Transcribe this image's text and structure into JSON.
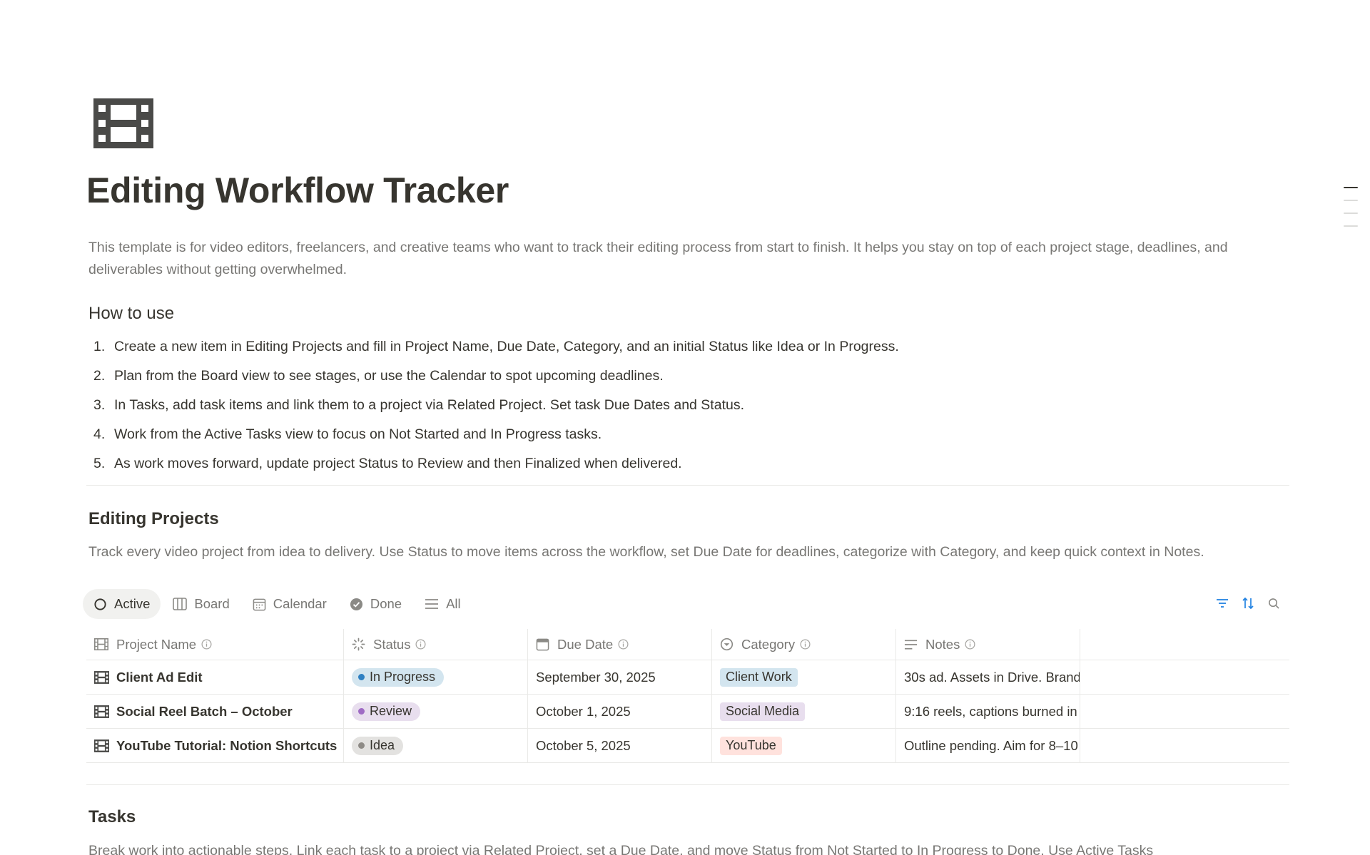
{
  "page": {
    "title": "Editing Workflow Tracker",
    "description": "This template is for video editors, freelancers, and creative teams who want to track their editing process from start to finish. It helps you stay on top of each project stage, deadlines, and deliverables without getting overwhelmed.",
    "icon": "film-icon"
  },
  "how_to_use": {
    "heading": "How to use",
    "steps": [
      {
        "num": "1.",
        "text": "Create a new item in Editing Projects and fill in Project Name, Due Date, Category, and an initial Status like Idea or In Progress."
      },
      {
        "num": "2.",
        "text": "Plan from the Board view to see stages, or use the Calendar to spot upcoming deadlines."
      },
      {
        "num": "3.",
        "text": "In Tasks, add task items and link them to a project via Related Project. Set task Due Dates and Status."
      },
      {
        "num": "4.",
        "text": "Work from the Active Tasks view to focus on Not Started and In Progress tasks."
      },
      {
        "num": "5.",
        "text": "As work moves forward, update project Status to Review and then Finalized when delivered."
      }
    ]
  },
  "projects": {
    "heading": "Editing Projects",
    "description": "Track every video project from idea to delivery. Use Status to move items across the workflow, set Due Date for deadlines, categorize with Category, and keep quick context in Notes.",
    "tabs": [
      {
        "label": "Active",
        "icon": "circle-icon"
      },
      {
        "label": "Board",
        "icon": "board-icon"
      },
      {
        "label": "Calendar",
        "icon": "calendar-icon"
      },
      {
        "label": "Done",
        "icon": "check-circle-icon"
      },
      {
        "label": "All",
        "icon": "list-icon"
      }
    ],
    "columns": [
      "Project Name",
      "Status",
      "Due Date",
      "Category",
      "Notes"
    ],
    "rows": [
      {
        "name": "Client Ad Edit",
        "status": "In Progress",
        "due": "September 30, 2025",
        "category": "Client Work",
        "notes": "30s ad. Assets in Drive. Brand"
      },
      {
        "name": "Social Reel Batch – October",
        "status": "Review",
        "due": "October 1, 2025",
        "category": "Social Media",
        "notes": "9:16 reels, captions burned in"
      },
      {
        "name": "YouTube Tutorial: Notion Shortcuts",
        "status": "Idea",
        "due": "October 5, 2025",
        "category": "YouTube",
        "notes": "Outline pending. Aim for 8–10"
      }
    ]
  },
  "tasks": {
    "heading": "Tasks",
    "description": "Break work into actionable steps. Link each task to a project via Related Project, set a Due Date, and move Status from Not Started to In Progress to Done. Use Active Tasks"
  },
  "colors": {
    "status_in_progress_bg": "#d3e5ef",
    "status_in_progress_dot": "#2f80c2",
    "status_review_bg": "#e8deee",
    "status_review_dot": "#9f6bc4",
    "status_idea_bg": "#e3e2e0",
    "status_idea_dot": "#8e8b86",
    "cat_client_bg": "#d3e5ef",
    "cat_social_bg": "#e8deee",
    "cat_youtube_bg": "#ffe2dd",
    "accent_blue": "#2383e2"
  }
}
